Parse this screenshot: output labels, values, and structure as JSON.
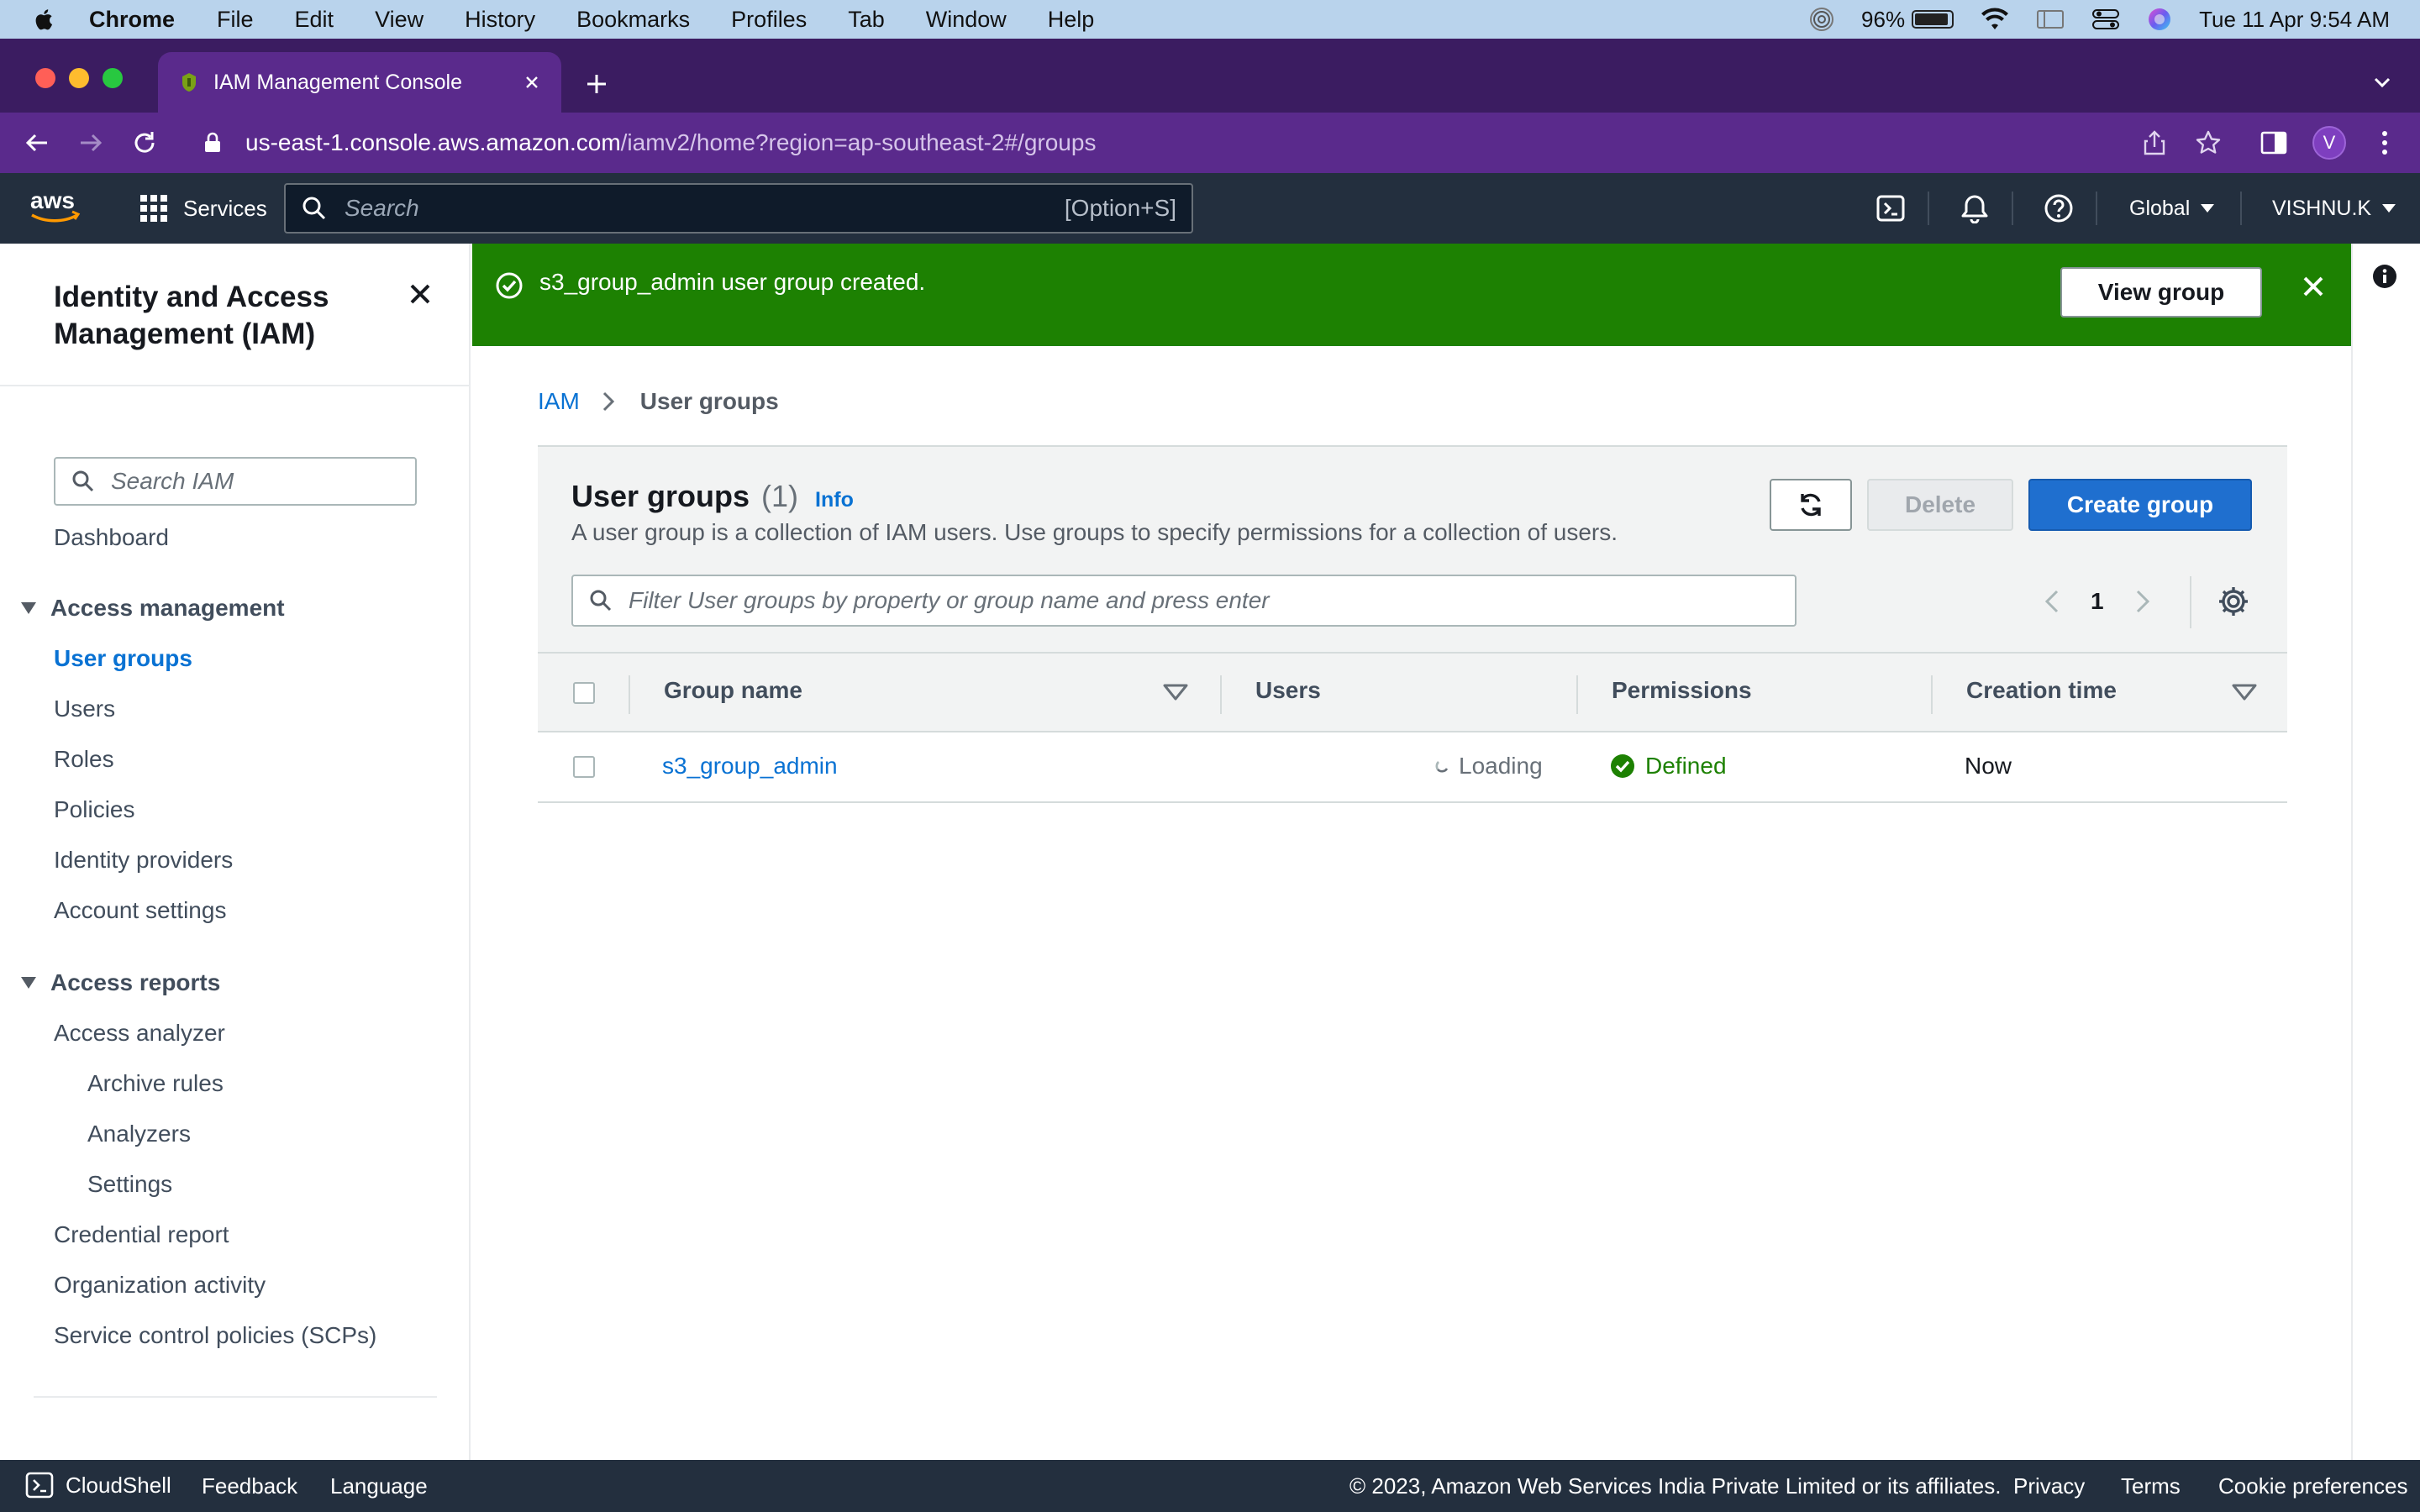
{
  "menubar": {
    "items": [
      "Chrome",
      "File",
      "Edit",
      "View",
      "History",
      "Bookmarks",
      "Profiles",
      "Tab",
      "Window",
      "Help"
    ],
    "battery": "96%",
    "datetime": "Tue 11 Apr  9:54 AM"
  },
  "browser": {
    "tab_title": "IAM Management Console",
    "url_host": "us-east-1.console.aws.amazon.com",
    "url_path": "/iamv2/home?region=ap-southeast-2#/groups",
    "profile_initial": "V"
  },
  "aws_header": {
    "logo": "aws",
    "services_label": "Services",
    "search_placeholder": "Search",
    "search_shortcut": "[Option+S]",
    "region": "Global",
    "user": "VISHNU.K"
  },
  "sidebar": {
    "title": "Identity and Access Management (IAM)",
    "search_placeholder": "Search IAM",
    "dashboard": "Dashboard",
    "access_management": {
      "label": "Access management",
      "items": [
        "User groups",
        "Users",
        "Roles",
        "Policies",
        "Identity providers",
        "Account settings"
      ]
    },
    "access_reports": {
      "label": "Access reports",
      "analyzer": "Access analyzer",
      "analyzer_children": [
        "Archive rules",
        "Analyzers",
        "Settings"
      ],
      "items": [
        "Credential report",
        "Organization activity",
        "Service control policies (SCPs)"
      ]
    }
  },
  "flash": {
    "message": "s3_group_admin user group created.",
    "button": "View group"
  },
  "breadcrumb": {
    "root": "IAM",
    "current": "User groups"
  },
  "panel": {
    "title": "User groups",
    "count": "(1)",
    "info": "Info",
    "description": "A user group is a collection of IAM users. Use groups to specify permissions for a collection of users.",
    "delete_label": "Delete",
    "create_label": "Create group",
    "filter_placeholder": "Filter User groups by property or group name and press enter",
    "page": "1"
  },
  "table": {
    "columns": [
      "Group name",
      "Users",
      "Permissions",
      "Creation time"
    ],
    "rows": [
      {
        "group_name": "s3_group_admin",
        "users": "Loading",
        "permissions": "Defined",
        "creation_time": "Now"
      }
    ]
  },
  "footer": {
    "cloudshell": "CloudShell",
    "feedback": "Feedback",
    "language": "Language",
    "copyright": "© 2023, Amazon Web Services India Private Limited or its affiliates.",
    "privacy": "Privacy",
    "terms": "Terms",
    "cookies": "Cookie preferences"
  },
  "colors": {
    "success_green": "#1d8102",
    "link_blue": "#0972d3",
    "aws_header": "#232f3e",
    "browser_purple": "#5a2a8c",
    "primary_button": "#1f6fcf"
  }
}
